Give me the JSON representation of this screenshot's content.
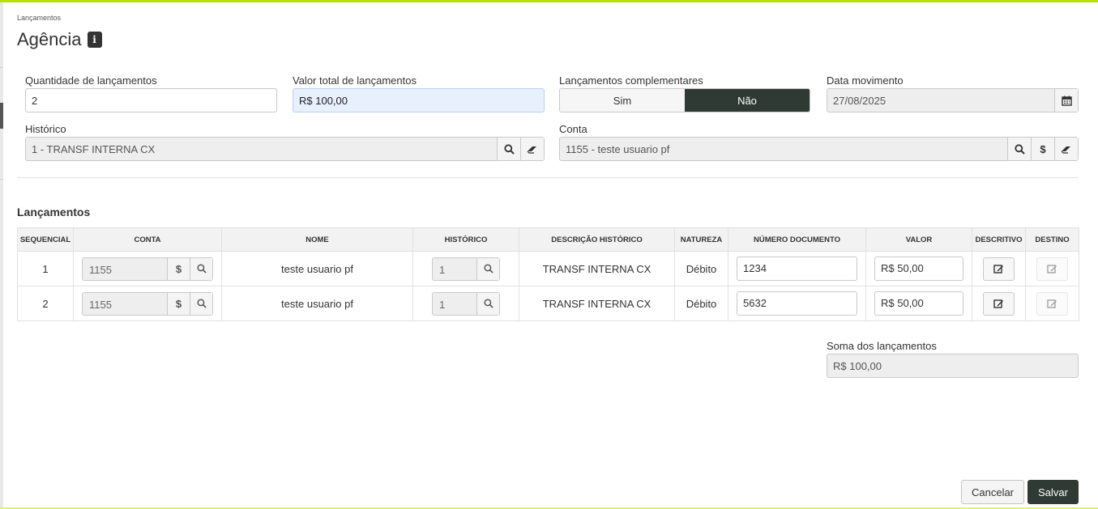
{
  "breadcrumb": "Lançamentos",
  "title": "Agência",
  "info_icon": "i",
  "form": {
    "quantidade_label": "Quantidade de lançamentos",
    "quantidade_value": "2",
    "valor_total_label": "Valor total de lançamentos",
    "valor_total_value": "R$ 100,00",
    "complementares_label": "Lançamentos complementares",
    "complementares_sim": "Sim",
    "complementares_nao": "Não",
    "complementares_selected": "Não",
    "data_label": "Data movimento",
    "data_value": "27/08/2025",
    "historico_label": "Histórico",
    "historico_value": "1 - TRANSF INTERNA CX",
    "conta_label": "Conta",
    "conta_value": "1155 - teste usuario pf",
    "dollar_symbol": "$"
  },
  "lancamentos": {
    "title": "Lançamentos",
    "columns": [
      "SEQUENCIAL",
      "CONTA",
      "NOME",
      "HISTÓRICO",
      "DESCRIÇÃO HISTÓRICO",
      "NATUREZA",
      "NÚMERO DOCUMENTO",
      "VALOR",
      "DESCRITIVO",
      "DESTINO"
    ],
    "rows": [
      {
        "sequencial": "1",
        "conta": "1155",
        "nome": "teste usuario pf",
        "historico": "1",
        "descricao": "TRANSF INTERNA CX",
        "natureza": "Débito",
        "numero_documento": "1234",
        "valor": "R$ 50,00"
      },
      {
        "sequencial": "2",
        "conta": "1155",
        "nome": "teste usuario pf",
        "historico": "1",
        "descricao": "TRANSF INTERNA CX",
        "natureza": "Débito",
        "numero_documento": "5632",
        "valor": "R$ 50,00"
      }
    ]
  },
  "soma": {
    "label": "Soma dos lançamentos",
    "value": "R$ 100,00"
  },
  "actions": {
    "cancel": "Cancelar",
    "save": "Salvar"
  },
  "colors": {
    "accent": "#b7e000",
    "dark": "#2e3a33"
  }
}
